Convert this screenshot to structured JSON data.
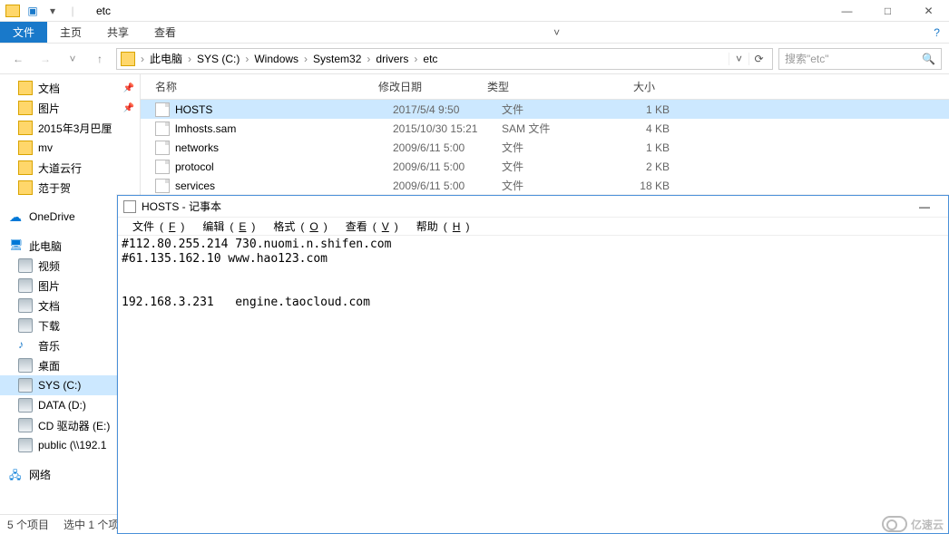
{
  "window": {
    "title": "etc",
    "min": "—",
    "max": "□",
    "close": "✕"
  },
  "ribbon": {
    "file": "文件",
    "home": "主页",
    "share": "共享",
    "view": "查看"
  },
  "nav": {
    "back": "←",
    "forward": "→",
    "dropdown": "˅",
    "up": "↑"
  },
  "breadcrumb": [
    "此电脑",
    "SYS (C:)",
    "Windows",
    "System32",
    "drivers",
    "etc"
  ],
  "search": {
    "placeholder": "搜索\"etc\""
  },
  "sidebar": {
    "quick": [
      {
        "label": "文档",
        "pin": true
      },
      {
        "label": "图片",
        "pin": true
      },
      {
        "label": "2015年3月巴厘",
        "pin": false
      },
      {
        "label": "mv",
        "pin": false
      },
      {
        "label": "大道云行",
        "pin": false
      },
      {
        "label": "范于贺",
        "pin": false
      }
    ],
    "onedrive": "OneDrive",
    "thispc": "此电脑",
    "pcitems": [
      "视频",
      "图片",
      "文档",
      "下载",
      "音乐",
      "桌面",
      "SYS (C:)",
      "DATA (D:)",
      "CD 驱动器 (E:)",
      "public (\\\\192.1"
    ],
    "network": "网络"
  },
  "columns": {
    "name": "名称",
    "date": "修改日期",
    "type": "类型",
    "size": "大小"
  },
  "files": [
    {
      "name": "HOSTS",
      "date": "2017/5/4 9:50",
      "type": "文件",
      "size": "1 KB",
      "selected": true
    },
    {
      "name": "lmhosts.sam",
      "date": "2015/10/30 15:21",
      "type": "SAM 文件",
      "size": "4 KB",
      "selected": false
    },
    {
      "name": "networks",
      "date": "2009/6/11 5:00",
      "type": "文件",
      "size": "1 KB",
      "selected": false
    },
    {
      "name": "protocol",
      "date": "2009/6/11 5:00",
      "type": "文件",
      "size": "2 KB",
      "selected": false
    },
    {
      "name": "services",
      "date": "2009/6/11 5:00",
      "type": "文件",
      "size": "18 KB",
      "selected": false
    }
  ],
  "status": {
    "count": "5 个项目",
    "selection": "选中 1 个项"
  },
  "notepad": {
    "title": "HOSTS - 记事本",
    "menu": {
      "file": {
        "label": "文件",
        "accel": "F"
      },
      "edit": {
        "label": "编辑",
        "accel": "E"
      },
      "format": {
        "label": "格式",
        "accel": "O"
      },
      "view": {
        "label": "查看",
        "accel": "V"
      },
      "help": {
        "label": "帮助",
        "accel": "H"
      }
    },
    "body": "#112.80.255.214 730.nuomi.n.shifen.com\n#61.135.162.10 www.hao123.com\n\n\n192.168.3.231   engine.taocloud.com"
  },
  "watermark": "亿速云"
}
